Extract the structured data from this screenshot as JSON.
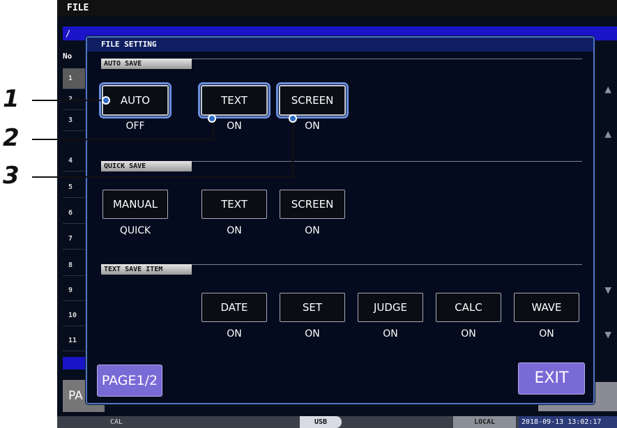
{
  "window": {
    "title": "FILE",
    "path": "/"
  },
  "background_list": {
    "header": "No",
    "rows": [
      "1",
      "2",
      "3",
      "4",
      "5",
      "6",
      "7",
      "8",
      "9",
      "10",
      "11"
    ],
    "page_button": "PA"
  },
  "dialog": {
    "title": "FILE SETTING",
    "auto_save": {
      "label": "AUTO SAVE",
      "buttons": [
        {
          "label": "AUTO",
          "value": "OFF"
        },
        {
          "label": "TEXT",
          "value": "ON"
        },
        {
          "label": "SCREEN",
          "value": "ON"
        }
      ]
    },
    "quick_save": {
      "label": "QUICK SAVE",
      "buttons": [
        {
          "label": "MANUAL",
          "value": "QUICK"
        },
        {
          "label": "TEXT",
          "value": "ON"
        },
        {
          "label": "SCREEN",
          "value": "ON"
        }
      ]
    },
    "text_save_item": {
      "label": "TEXT SAVE ITEM",
      "buttons": [
        {
          "label": "DATE",
          "value": "ON"
        },
        {
          "label": "SET",
          "value": "ON"
        },
        {
          "label": "JUDGE",
          "value": "ON"
        },
        {
          "label": "CALC",
          "value": "ON"
        },
        {
          "label": "WAVE",
          "value": "ON"
        }
      ]
    },
    "page_button": "PAGE1/2",
    "exit_button": "EXIT"
  },
  "status_bar": {
    "cal": "CAL",
    "usb": "USB",
    "local": "LOCAL",
    "datetime": "2018-09-13 13:02:17"
  },
  "callouts": [
    "1",
    "2",
    "3"
  ],
  "colors": {
    "accent": "#7a6ad6",
    "highlight": "#6b8fe0",
    "path_bar": "#1a14c8"
  }
}
